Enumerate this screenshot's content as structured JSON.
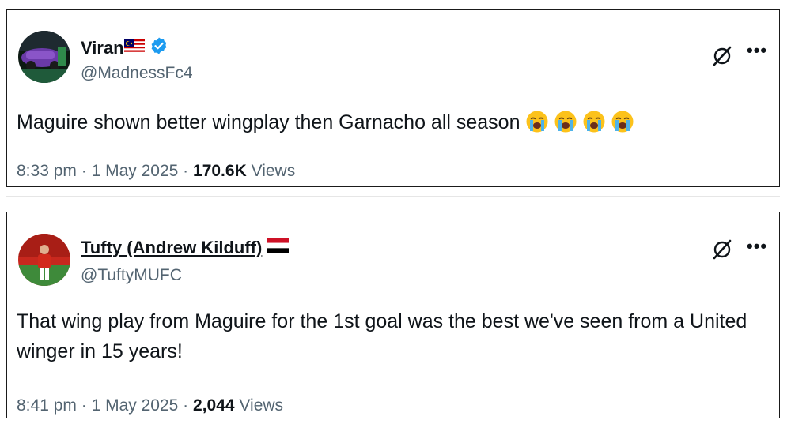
{
  "tweets": [
    {
      "display_name": "Viran",
      "handle": "@MadnessFc4",
      "verified": true,
      "flag": "malaysia-flag-icon",
      "text": "Maguire shown better wingplay then Garnacho all season",
      "emoji": [
        "loudly-crying-face",
        "loudly-crying-face",
        "loudly-crying-face",
        "loudly-crying-face"
      ],
      "time": "8:33 pm",
      "date": "1 May 2025",
      "views_count": "170.6K",
      "views_label": "Views"
    },
    {
      "display_name": "Tufty (Andrew Kilduff)",
      "handle": "@TuftyMUFC",
      "verified": false,
      "flag": "yemen-flag-icon",
      "text": "That wing play from Maguire for the 1st goal was the best we've seen from a United winger in 15 years!",
      "time": "8:41 pm",
      "date": "1 May 2025",
      "views_count": "2,044",
      "views_label": "Views"
    }
  ],
  "separator": "·",
  "colors": {
    "text": "#0f1419",
    "secondary": "#536471",
    "verified": "#1d9bf0",
    "border": "#1a1a1a"
  }
}
